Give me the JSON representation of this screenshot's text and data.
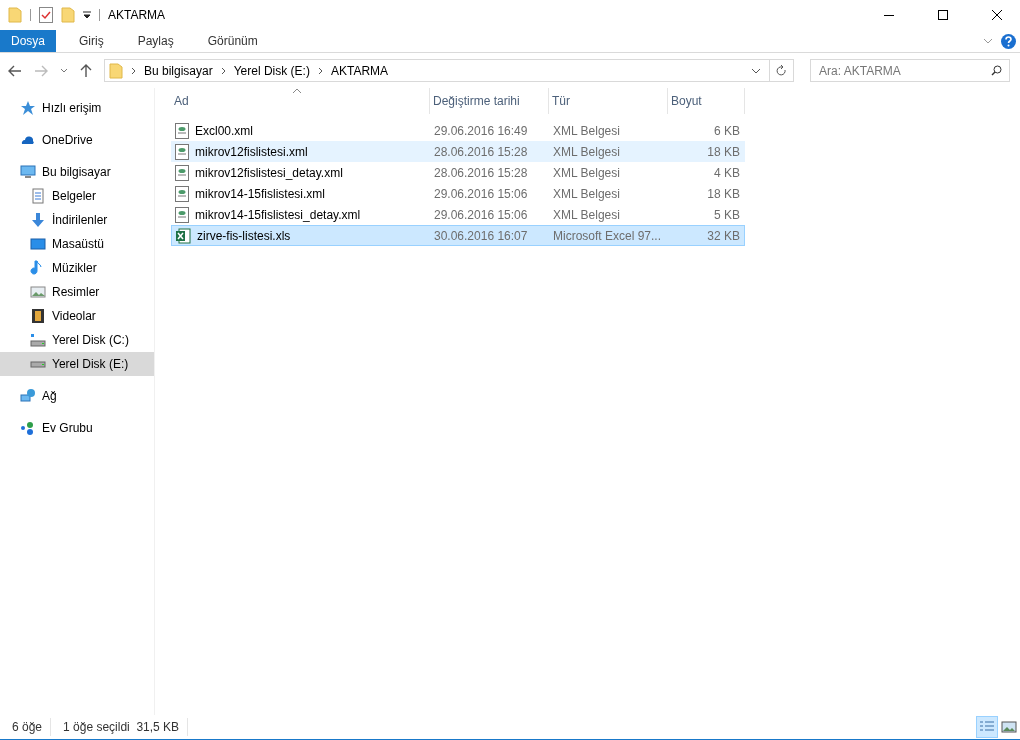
{
  "window": {
    "title": "AKTARMA"
  },
  "ribbon_tabs": [
    {
      "label": "Dosya",
      "selected": true
    },
    {
      "label": "Giriş",
      "selected": false
    },
    {
      "label": "Paylaş",
      "selected": false
    },
    {
      "label": "Görünüm",
      "selected": false
    }
  ],
  "breadcrumb": [
    "Bu bilgisayar",
    "Yerel Disk (E:)",
    "AKTARMA"
  ],
  "search": {
    "placeholder": "Ara: AKTARMA"
  },
  "sidebar": {
    "items": [
      {
        "kind": "quick",
        "label": "Hızlı erişim",
        "selected": false
      },
      {
        "kind": "cloud",
        "label": "OneDrive",
        "selected": false
      },
      {
        "kind": "pc",
        "label": "Bu bilgisayar",
        "selected": false,
        "children": [
          {
            "kind": "docs",
            "label": "Belgeler",
            "selected": false
          },
          {
            "kind": "downloads",
            "label": "İndirilenler",
            "selected": false
          },
          {
            "kind": "desktop",
            "label": "Masaüstü",
            "selected": false
          },
          {
            "kind": "music",
            "label": "Müzikler",
            "selected": false
          },
          {
            "kind": "pictures",
            "label": "Resimler",
            "selected": false
          },
          {
            "kind": "videos",
            "label": "Videolar",
            "selected": false
          },
          {
            "kind": "drive-system",
            "label": "Yerel Disk (C:)",
            "selected": false
          },
          {
            "kind": "drive",
            "label": "Yerel Disk (E:)",
            "selected": true
          }
        ]
      },
      {
        "kind": "network",
        "label": "Ağ",
        "selected": false
      },
      {
        "kind": "homegroup",
        "label": "Ev Grubu",
        "selected": false
      }
    ]
  },
  "table": {
    "columns": [
      "Ad",
      "Değiştirme tarihi",
      "Tür",
      "Boyut"
    ],
    "rows": [
      {
        "kind": "xml",
        "name": "Excl00.xml",
        "date": "29.06.2016 16:49",
        "type": "XML Belgesi",
        "size": "6 KB",
        "selected": false,
        "hovered": false
      },
      {
        "kind": "xml",
        "name": "mikrov12fislistesi.xml",
        "date": "28.06.2016 15:28",
        "type": "XML Belgesi",
        "size": "18 KB",
        "selected": false,
        "hovered": true
      },
      {
        "kind": "xml",
        "name": "mikrov12fislistesi_detay.xml",
        "date": "28.06.2016 15:28",
        "type": "XML Belgesi",
        "size": "4 KB",
        "selected": false,
        "hovered": false
      },
      {
        "kind": "xml",
        "name": "mikrov14-15fislistesi.xml",
        "date": "29.06.2016 15:06",
        "type": "XML Belgesi",
        "size": "18 KB",
        "selected": false,
        "hovered": false
      },
      {
        "kind": "xml",
        "name": "mikrov14-15fislistesi_detay.xml",
        "date": "29.06.2016 15:06",
        "type": "XML Belgesi",
        "size": "5 KB",
        "selected": false,
        "hovered": false
      },
      {
        "kind": "excel",
        "name": "zirve-fis-listesi.xls",
        "date": "30.06.2016 16:07",
        "type": "Microsoft Excel 97...",
        "size": "32 KB",
        "selected": true,
        "hovered": false
      }
    ]
  },
  "status_bar": {
    "count": "6 öğe",
    "selection": "1 öğe seçildi  31,5 KB",
    "views": [
      {
        "kind": "details",
        "selected": true
      },
      {
        "kind": "large",
        "selected": false
      }
    ]
  }
}
